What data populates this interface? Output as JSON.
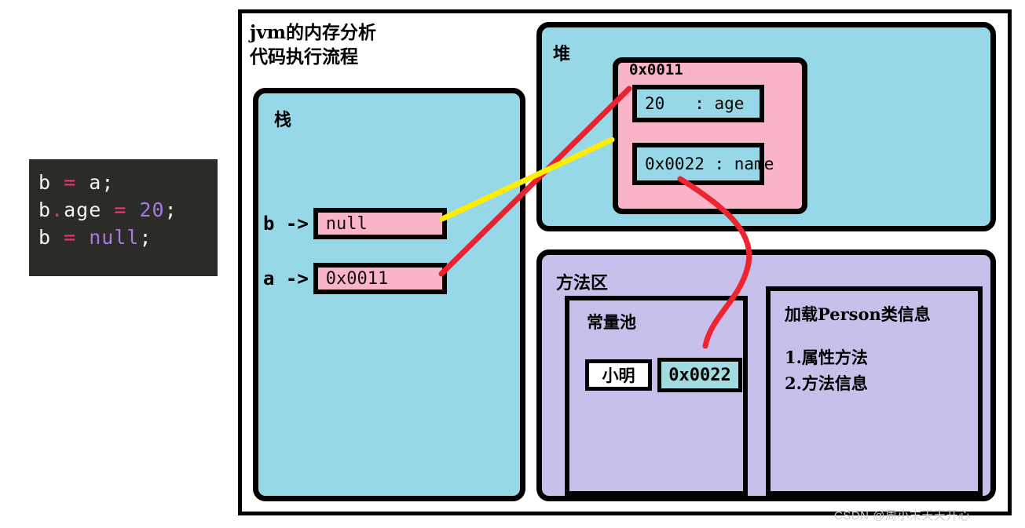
{
  "code_panel": {
    "lines": [
      [
        {
          "t": "b",
          "c": "var"
        },
        {
          "t": " ",
          "c": "var"
        },
        {
          "t": "=",
          "c": "op"
        },
        {
          "t": " ",
          "c": "var"
        },
        {
          "t": "a",
          "c": "var"
        },
        {
          "t": ";",
          "c": "semi"
        }
      ],
      [
        {
          "t": "b",
          "c": "var"
        },
        {
          "t": ".",
          "c": "dot"
        },
        {
          "t": "age",
          "c": "var"
        },
        {
          "t": " ",
          "c": "var"
        },
        {
          "t": "=",
          "c": "op"
        },
        {
          "t": " ",
          "c": "var"
        },
        {
          "t": "20",
          "c": "num"
        },
        {
          "t": ";",
          "c": "semi"
        }
      ],
      [
        {
          "t": "b",
          "c": "var"
        },
        {
          "t": " ",
          "c": "var"
        },
        {
          "t": "=",
          "c": "op"
        },
        {
          "t": " ",
          "c": "var"
        },
        {
          "t": "null",
          "c": "kw"
        },
        {
          "t": ";",
          "c": "semi"
        }
      ]
    ],
    "plain_text": "b = a;\nb.age = 20;\nb = null;",
    "background": "#2b2b28"
  },
  "title": {
    "line1": "jvm的内存分析",
    "line2": "代码执行流程"
  },
  "stack": {
    "label": "栈",
    "fill": "#96d8e8",
    "slots": [
      {
        "name": "b",
        "arrow": "b ->",
        "value": "null"
      },
      {
        "name": "a",
        "arrow": "a ->",
        "value": "0x0011"
      }
    ]
  },
  "heap": {
    "label": "堆",
    "fill": "#96d8e8",
    "object": {
      "address": "0x0011",
      "fill": "#fab4c8",
      "fields": [
        {
          "value": "20",
          "separator": ":",
          "name": "age",
          "text": "20   : age"
        },
        {
          "value": "0x0022",
          "separator": ":",
          "name": "name",
          "text": "0x0022 : name"
        }
      ]
    }
  },
  "method_area": {
    "label": "方法区",
    "fill": "#c8c0ea",
    "constant_pool": {
      "label": "常量池",
      "cells": [
        {
          "text": "小明",
          "fill": "#ffffff"
        },
        {
          "text": "0x0022",
          "fill": "#a0dce0"
        }
      ]
    },
    "class_info": {
      "title": "加载Person类信息",
      "items": [
        "1.属性方法",
        "2.方法信息"
      ]
    }
  },
  "connectors": [
    {
      "name": "a-to-age-object",
      "color": "#e8222e",
      "kind": "line"
    },
    {
      "name": "b-to-object",
      "color": "#ffee00",
      "kind": "line"
    },
    {
      "name": "name-to-constant-pool",
      "color": "#ee2430",
      "kind": "curve"
    }
  ],
  "watermark": "CSDN @周小末天天开心",
  "colors": {
    "pink": "#fab4c8",
    "light_blue": "#96d8e8",
    "purple": "#c8c0ea",
    "teal": "#a0dce0",
    "red": "#e8222e",
    "yellow": "#ffee00",
    "outline": "#000000"
  }
}
